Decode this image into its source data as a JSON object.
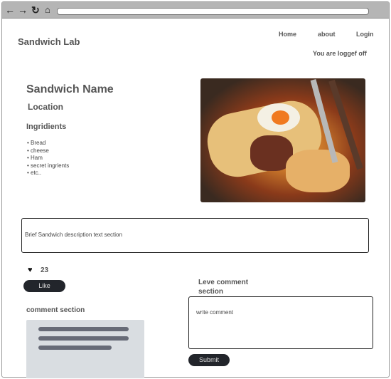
{
  "browser": {
    "url": ""
  },
  "header": {
    "site_title": "Sandwich Lab",
    "nav": [
      "Home",
      "about",
      "Login"
    ],
    "status": "You are loggef off"
  },
  "sandwich": {
    "name": "Sandwich Name",
    "location": "Location",
    "ingredients_heading": "Ingridients",
    "ingredients": [
      "Bread",
      "cheese",
      "Ham",
      "secret ingrients",
      "etc.."
    ],
    "description": "Brief Sandwich description text section"
  },
  "likes": {
    "count": "23",
    "like_label": "Like"
  },
  "comments": {
    "heading": "comment section",
    "leave_heading": "Leve comment section",
    "input_placeholder": "write comment",
    "submit_label": "Submit"
  }
}
